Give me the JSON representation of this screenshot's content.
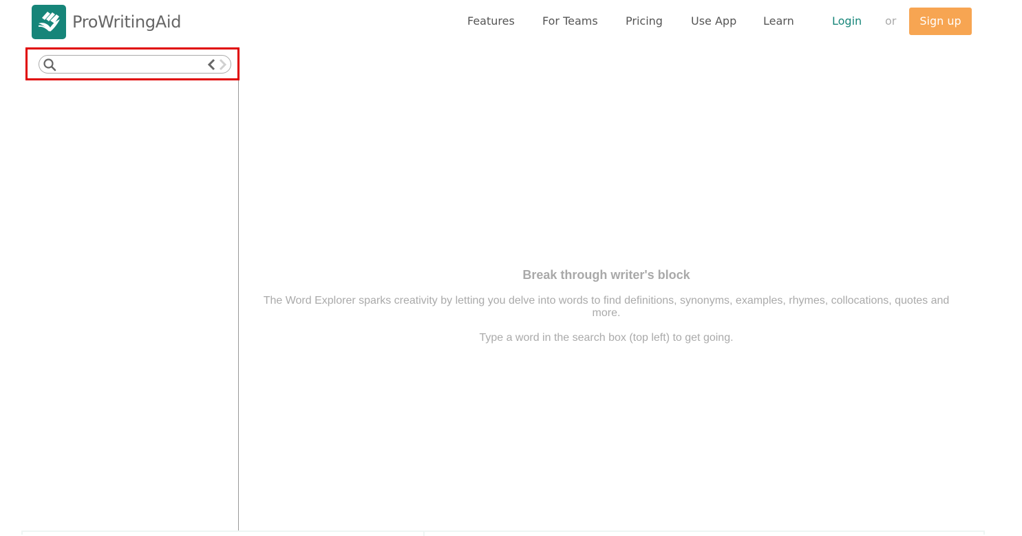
{
  "brand": {
    "name": "ProWritingAid",
    "logo_color": "#168579"
  },
  "nav": {
    "items": [
      {
        "label": "Features"
      },
      {
        "label": "For Teams"
      },
      {
        "label": "Pricing"
      },
      {
        "label": "Use App"
      },
      {
        "label": "Learn"
      }
    ],
    "login_label": "Login",
    "separator": "or",
    "signup_label": "Sign up"
  },
  "colors": {
    "accent": "#168579",
    "signup": "#f7a552",
    "highlight": "#e00000"
  },
  "search": {
    "value": "",
    "placeholder": ""
  },
  "empty_state": {
    "title": "Break through writer's block",
    "description": "The Word Explorer sparks creativity by letting you delve into words to find definitions, synonyms, examples, rhymes, collocations, quotes and more.",
    "hint": "Type a word in the search box (top left) to get going."
  }
}
